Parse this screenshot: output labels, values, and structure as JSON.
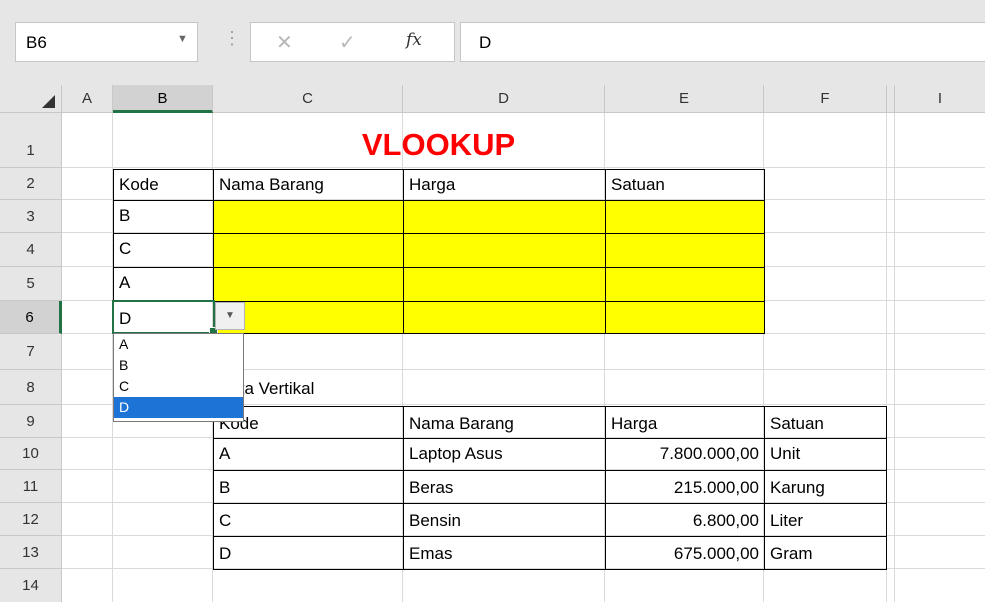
{
  "formula_bar": {
    "name_box": "B6",
    "formula": "D"
  },
  "columns": [
    "A",
    "B",
    "C",
    "D",
    "E",
    "F",
    "I"
  ],
  "rows": [
    "1",
    "2",
    "3",
    "4",
    "5",
    "6",
    "7",
    "8",
    "9",
    "10",
    "11",
    "12",
    "13",
    "14"
  ],
  "sheet": {
    "title": "VLOOKUP",
    "lookup_headers": [
      "Kode",
      "Nama Barang",
      "Harga",
      "Satuan"
    ],
    "lookup_codes": [
      "B",
      "C",
      "A",
      "D"
    ],
    "table_caption": "Data Vertikal",
    "data_headers": [
      "Kode",
      "Nama Barang",
      "Harga",
      "Satuan"
    ],
    "data_rows": [
      [
        "A",
        "Laptop Asus",
        "7.800.000,00",
        "Unit"
      ],
      [
        "B",
        "Beras",
        "215.000,00",
        "Karung"
      ],
      [
        "C",
        "Bensin",
        "6.800,00",
        "Liter"
      ],
      [
        "D",
        "Emas",
        "675.000,00",
        "Gram"
      ]
    ]
  },
  "dropdown": {
    "options": [
      "A",
      "B",
      "C",
      "D"
    ],
    "selected": "D"
  },
  "colors": {
    "accent": "#217346",
    "title": "#ff0000",
    "highlight": "#ffff00",
    "selection": "#1e73d6"
  }
}
